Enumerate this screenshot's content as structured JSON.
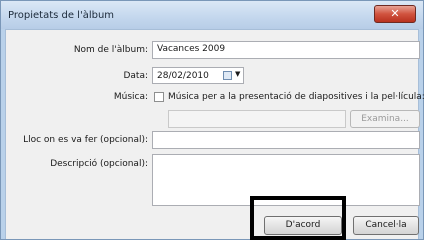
{
  "dialog": {
    "title": "Propietats de l'àlbum",
    "close_symbol": "✕"
  },
  "form": {
    "album_name_label": "Nom de l'àlbum:",
    "album_name_value": "Vacances 2009",
    "date_label": "Data:",
    "date_value": "28/02/2010",
    "date_dropdown_arrow": "▼",
    "music_label": "Música:",
    "music_checkbox_label": "Música per a la presentació de diapositives i la pel·lícula:",
    "music_file_value": "",
    "browse_button_label": "Examina...",
    "location_label": "Lloc on es va fer (opcional):",
    "location_value": "",
    "description_label": "Descripció (opcional):",
    "description_value": ""
  },
  "buttons": {
    "ok_label": "D'acord",
    "cancel_label": "Cancel·la"
  }
}
